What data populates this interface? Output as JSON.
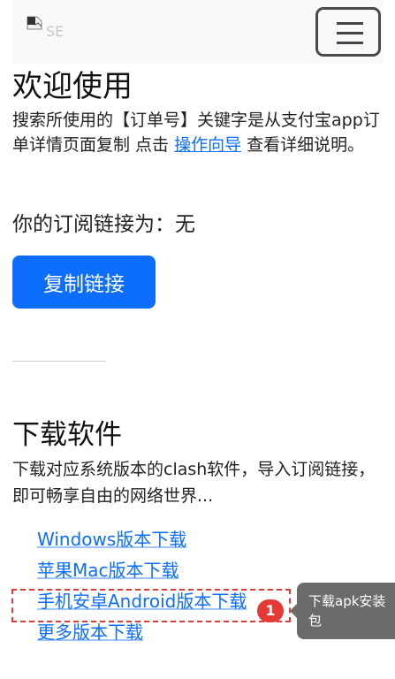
{
  "navbar": {
    "brand_alt": "SE",
    "menu_icon": "hamburger-menu-icon"
  },
  "welcome": {
    "title": "欢迎使用",
    "intro_before": "搜索所使用的【订单号】关键字是从支付宝app订单详情页面复制 点击 ",
    "guide_link": "操作向导",
    "intro_after": " 查看详细说明。"
  },
  "subscription": {
    "label": "你的订阅链接为：无",
    "copy_button": "复制链接"
  },
  "download": {
    "title": "下载软件",
    "description": "下载对应系统版本的clash软件，导入订阅链接，即可畅享自由的网络世界...",
    "links": [
      "Windows版本下载",
      "苹果Mac版本下载",
      "手机安卓Android版本下载",
      "更多版本下载"
    ]
  },
  "annotation": {
    "badge": "1",
    "tooltip": "下载apk安装包",
    "highlight_color": "#e53935"
  },
  "colors": {
    "accent": "#0d6efd",
    "tooltip_bg": "#6b6b6b"
  }
}
